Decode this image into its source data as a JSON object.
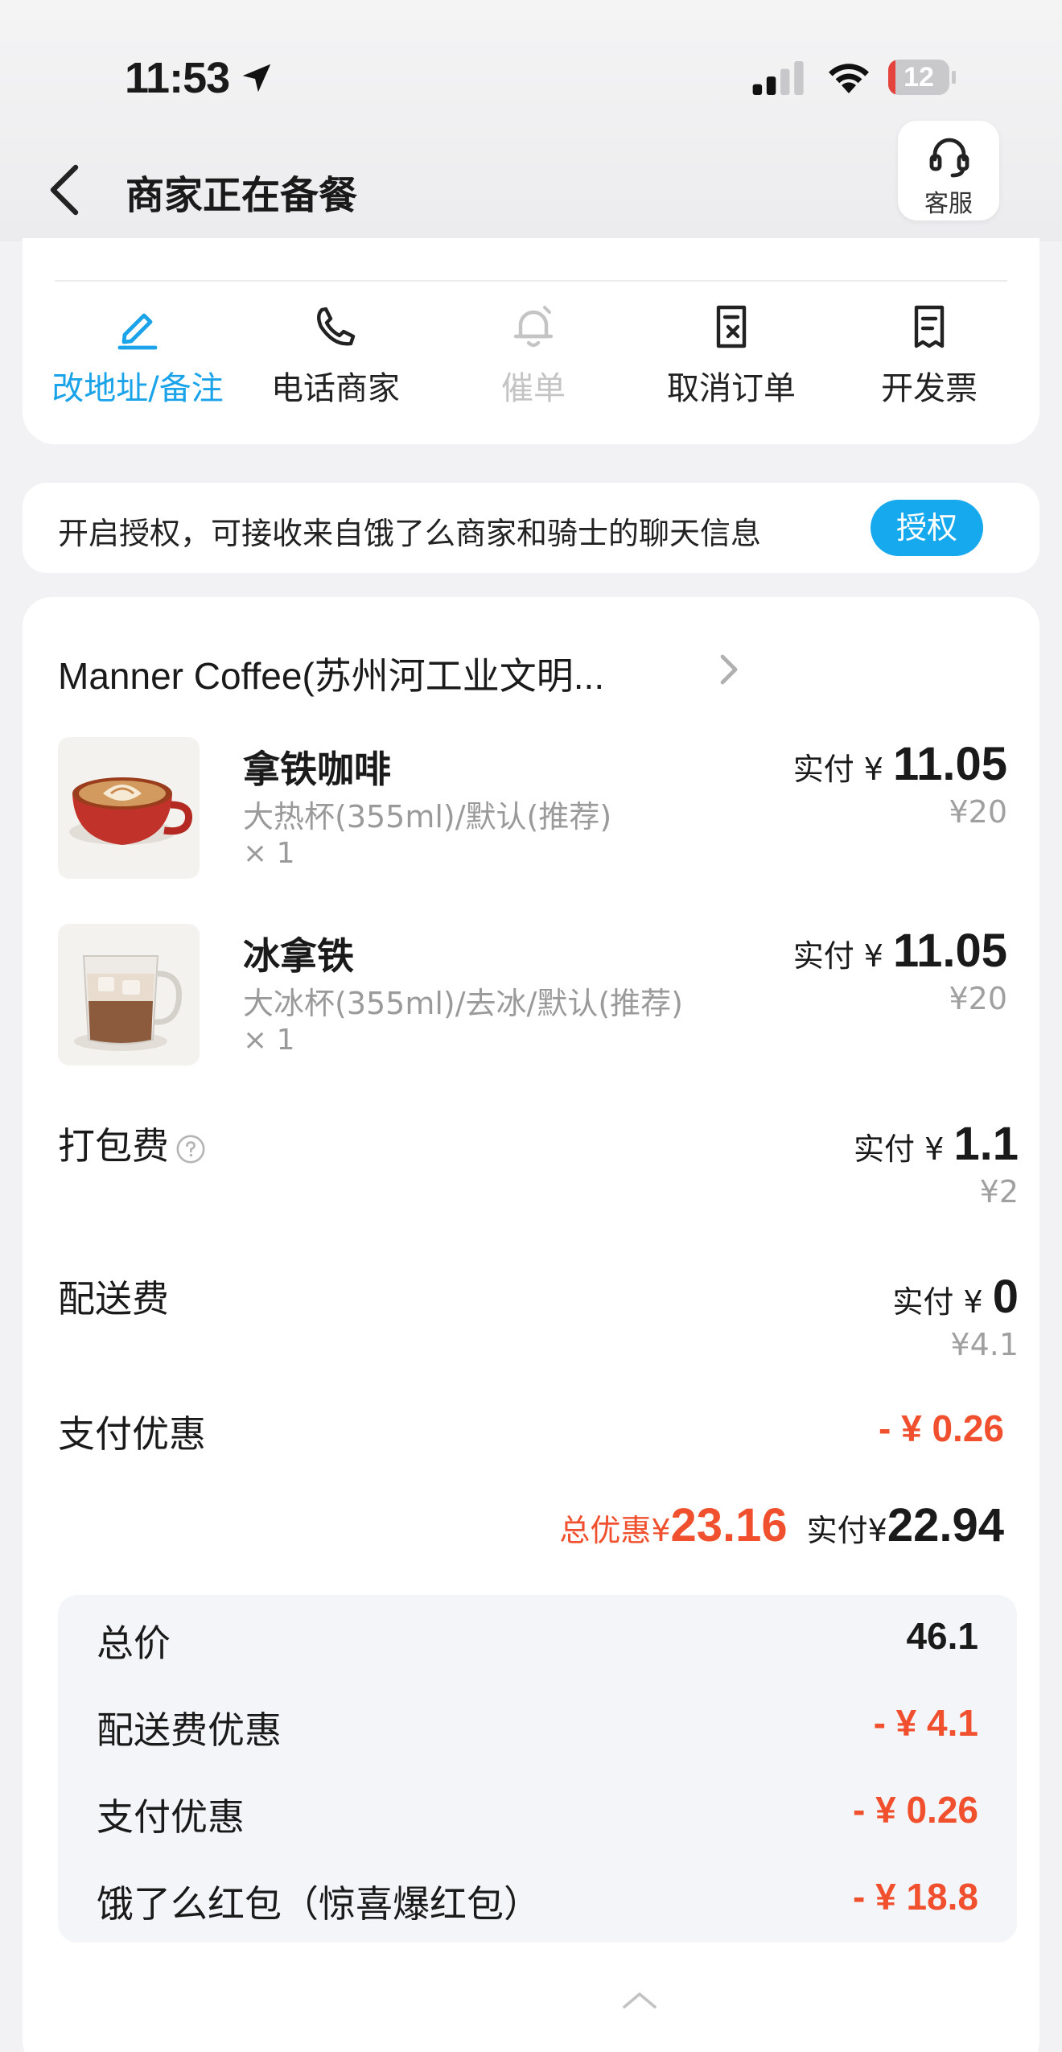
{
  "status_bar": {
    "time": "11:53",
    "battery_level": "12",
    "battery_fraction": 0.12,
    "battery_color": "#e4443b"
  },
  "nav": {
    "title": "商家正在备餐",
    "service_label": "客服"
  },
  "actions": [
    {
      "label": "改地址/备注",
      "icon": "edit-icon",
      "state": "active"
    },
    {
      "label": "电话商家",
      "icon": "phone-icon",
      "state": "normal"
    },
    {
      "label": "催单",
      "icon": "bell-icon",
      "state": "disabled"
    },
    {
      "label": "取消订单",
      "icon": "cancel-order-icon",
      "state": "normal"
    },
    {
      "label": "开发票",
      "icon": "invoice-icon",
      "state": "normal"
    }
  ],
  "auth": {
    "text": "开启授权，可接收来自饿了么商家和骑士的聊天信息",
    "button": "授权"
  },
  "shop": {
    "name": "Manner Coffee(苏州河工业文明..."
  },
  "items": [
    {
      "name": "拿铁咖啡",
      "spec": "大热杯(355ml)/默认(推荐)",
      "qty": "× 1",
      "paid_label": "实付 ¥ ",
      "paid": "11.05",
      "original": "¥20"
    },
    {
      "name": "冰拿铁",
      "spec": "大冰杯(355ml)/去冰/默认(推荐)",
      "qty": "× 1",
      "paid_label": "实付 ¥ ",
      "paid": "11.05",
      "original": "¥20"
    }
  ],
  "fees": {
    "packing": {
      "label": "打包费",
      "paid_label": "实付 ¥ ",
      "paid": "1.1",
      "original": "¥2"
    },
    "delivery": {
      "label": "配送费",
      "paid_label": "实付 ¥ ",
      "paid": "0",
      "original": "¥4.1"
    },
    "payment_discount": {
      "label": "支付优惠",
      "value": "- ¥ 0.26"
    }
  },
  "totals": {
    "discount_label": "总优惠¥",
    "discount": "23.16",
    "paid_label": "实付¥",
    "paid": "22.94"
  },
  "breakdown": [
    {
      "label": "总价",
      "value": "46.1"
    },
    {
      "label": "配送费优惠",
      "value": "- ¥ 4.1"
    },
    {
      "label": "支付优惠",
      "value": "- ¥ 0.26"
    },
    {
      "label": "饿了么红包（惊喜爆红包）",
      "value": "- ¥ 18.8"
    }
  ],
  "colors": {
    "accent_blue": "#1aa3e8",
    "discount_red": "#f0502e"
  }
}
